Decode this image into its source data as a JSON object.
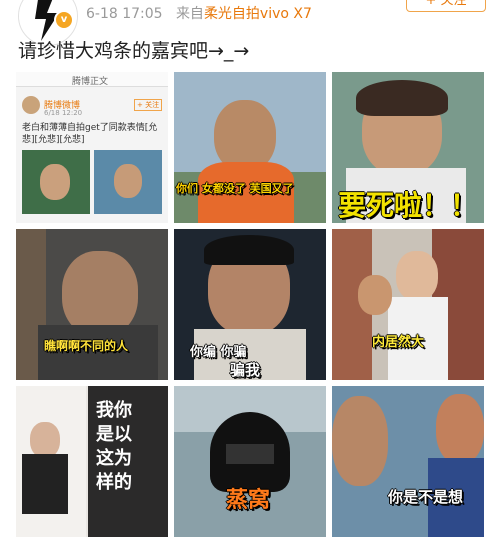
{
  "header": {
    "timestamp": "6-18 17:05",
    "source_prefix": "来自",
    "source_device": "柔光自拍vivo X7",
    "follow_label": "+ 关注",
    "verified_badge": "v"
  },
  "post": {
    "text": "请珍惜大鸡条的嘉宾吧→_→"
  },
  "images": [
    {
      "nav_title": "腾博正文",
      "user_name": "腾博微博",
      "time": "6/18 12:20",
      "body_text": "老白和薄薄自拍get了同款表情[允悲][允悲][允悲]",
      "follow": "+ 关注"
    },
    {
      "caption": "你们 女都没了 芙国又了"
    },
    {
      "caption": "要死啦！！"
    },
    {
      "caption": "瞧啊啊不同的人"
    },
    {
      "caption_top": "你编 你骗",
      "caption_bottom": "骗我"
    },
    {
      "caption": "内居然大"
    },
    {
      "caption_lines": [
        "我你",
        "是以",
        "这为",
        "样的"
      ]
    },
    {
      "caption": "蒸窝"
    },
    {
      "caption": "你是不是想"
    }
  ],
  "colors": {
    "accent_orange": "#e8790c",
    "meta_gray": "#9a9a9a",
    "badge_gold": "#f5a623"
  }
}
